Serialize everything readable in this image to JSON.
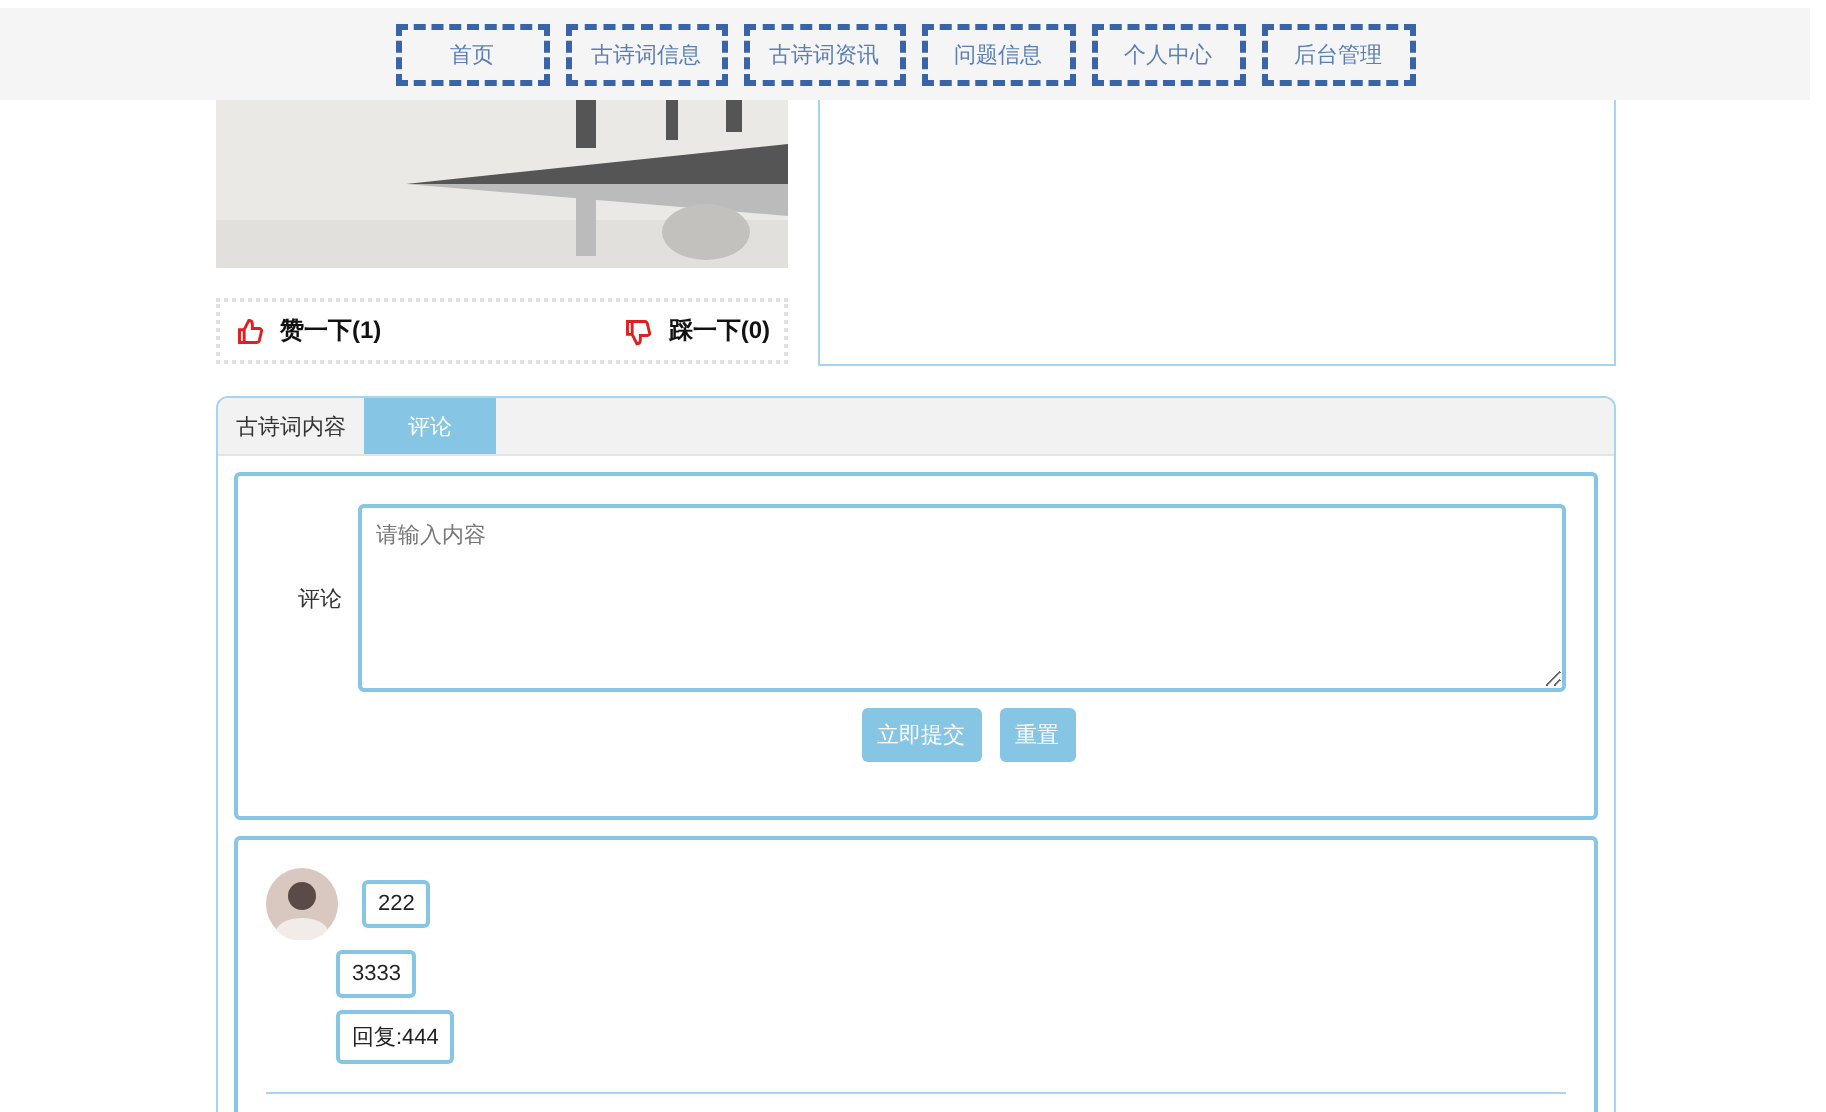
{
  "nav": [
    {
      "label": "首页"
    },
    {
      "label": "古诗词信息"
    },
    {
      "label": "古诗词资讯"
    },
    {
      "label": "问题信息"
    },
    {
      "label": "个人中心"
    },
    {
      "label": "后台管理"
    }
  ],
  "votes": {
    "like": "赞一下(1)",
    "dislike": "踩一下(0)"
  },
  "tabs": [
    {
      "label": "古诗词内容",
      "selected": false
    },
    {
      "label": "评论",
      "selected": true
    }
  ],
  "comment_form": {
    "label": "评论",
    "placeholder": "请输入内容",
    "buttons": [
      "立即提交",
      "重置"
    ]
  },
  "comments": [
    {
      "content": "222",
      "lines": [
        "3333",
        "回复:444"
      ]
    }
  ]
}
